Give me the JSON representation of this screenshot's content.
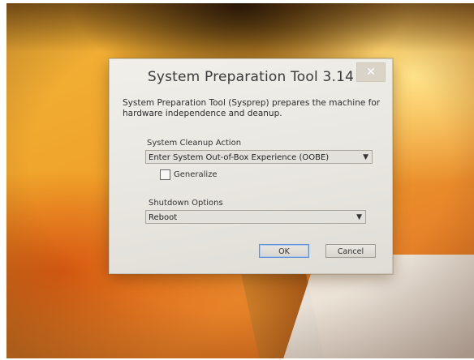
{
  "dialog": {
    "title": "System Preparation Tool 3.14",
    "close_glyph": "✕",
    "description": "System Preparation Tool (Sysprep) prepares the machine for hardware independence and deanup.",
    "cleanup": {
      "label": "System Cleanup Action",
      "selected": "Enter System Out-of-Box Experience (OOBE)",
      "chevron_icon": "chevron-down-icon"
    },
    "generalize": {
      "label": "Generalize",
      "checked": false
    },
    "shutdown": {
      "label": "Shutdown Options",
      "selected": "Reboot",
      "chevron_icon": "chevron-down-icon"
    },
    "buttons": {
      "ok": "OK",
      "cancel": "Cancel"
    }
  },
  "colors": {
    "wallpaper_orange": "#f0a22a",
    "dialog_background": "#e9e7e1",
    "default_button_border": "#5e8fd4"
  }
}
